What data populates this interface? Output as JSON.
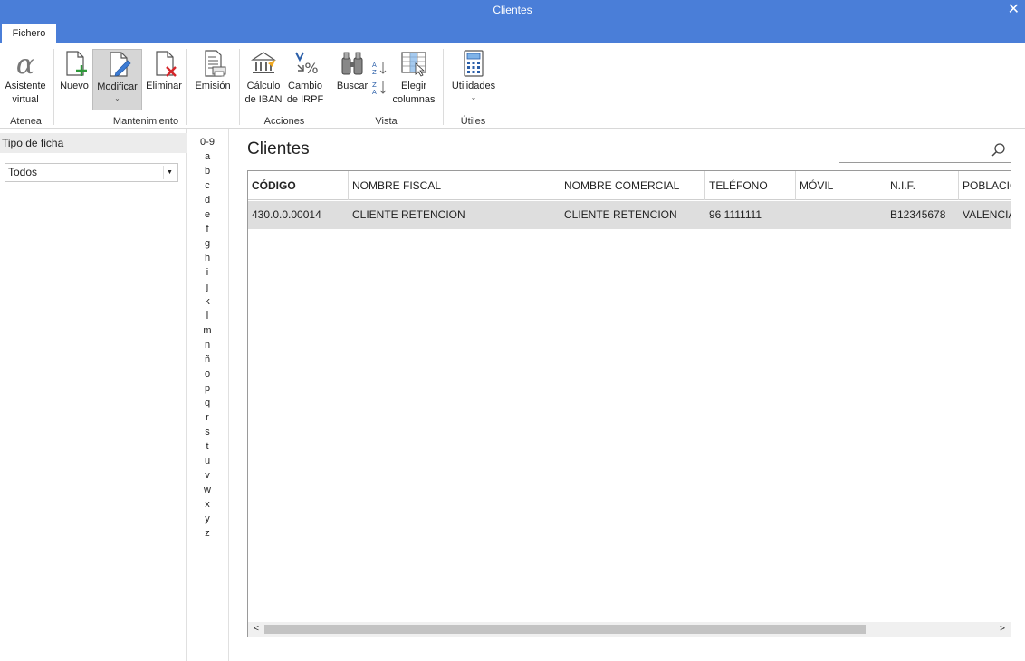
{
  "window": {
    "title": "Clientes",
    "close_glyph": "✕"
  },
  "tabs": [
    {
      "label": "Fichero"
    }
  ],
  "ribbon": {
    "groups": [
      {
        "label": "Atenea",
        "buttons": [
          {
            "label": "Asistente virtual",
            "icon": "alpha-icon"
          }
        ]
      },
      {
        "label": "Mantenimiento",
        "buttons": [
          {
            "label": "Nuevo",
            "icon": "new-document-icon"
          },
          {
            "label": "Modificar",
            "icon": "edit-document-icon",
            "dropdown": "⌄"
          },
          {
            "label": "Eliminar",
            "icon": "delete-document-icon"
          },
          {
            "label": "Emisión",
            "icon": "print-list-icon"
          }
        ]
      },
      {
        "label": "Acciones",
        "buttons": [
          {
            "label": "Cálculo de IBAN",
            "icon": "bank-icon"
          },
          {
            "label": "Cambio de IRPF",
            "icon": "percent-icon"
          }
        ]
      },
      {
        "label": "Vista",
        "buttons": [
          {
            "label": "Buscar",
            "icon": "binoculars-icon"
          },
          {
            "label": "",
            "icon": "sort-az-icon"
          },
          {
            "label": "",
            "icon": "sort-za-icon"
          },
          {
            "label": "Elegir columnas",
            "icon": "columns-icon"
          }
        ]
      },
      {
        "label": "Útiles",
        "buttons": [
          {
            "label": "Utilidades",
            "icon": "calculator-icon",
            "dropdown": "⌄"
          }
        ]
      }
    ]
  },
  "left_pane": {
    "header": "Tipo de ficha",
    "select_value": "Todos",
    "select_arrow": "▼"
  },
  "alphabet": [
    "0-9",
    "a",
    "b",
    "c",
    "d",
    "e",
    "f",
    "g",
    "h",
    "i",
    "j",
    "k",
    "l",
    "m",
    "n",
    "ñ",
    "o",
    "p",
    "q",
    "r",
    "s",
    "t",
    "u",
    "v",
    "w",
    "x",
    "y",
    "z"
  ],
  "main": {
    "title": "Clientes",
    "columns": [
      "CÓDIGO",
      "NOMBRE FISCAL",
      "NOMBRE COMERCIAL",
      "TELÉFONO",
      "MÓVIL",
      "N.I.F.",
      "POBLACIÓN"
    ],
    "rows": [
      [
        "430.0.0.00014",
        "CLIENTE RETENCION",
        "CLIENTE RETENCION",
        "96 1111111",
        "",
        "B12345678",
        "VALENCIA"
      ]
    ],
    "scroll_left": "<",
    "scroll_right": ">"
  },
  "colors": {
    "titlebar": "#4a7ed8",
    "selected_row": "#dedede",
    "active_button": "#d6d6d6"
  }
}
